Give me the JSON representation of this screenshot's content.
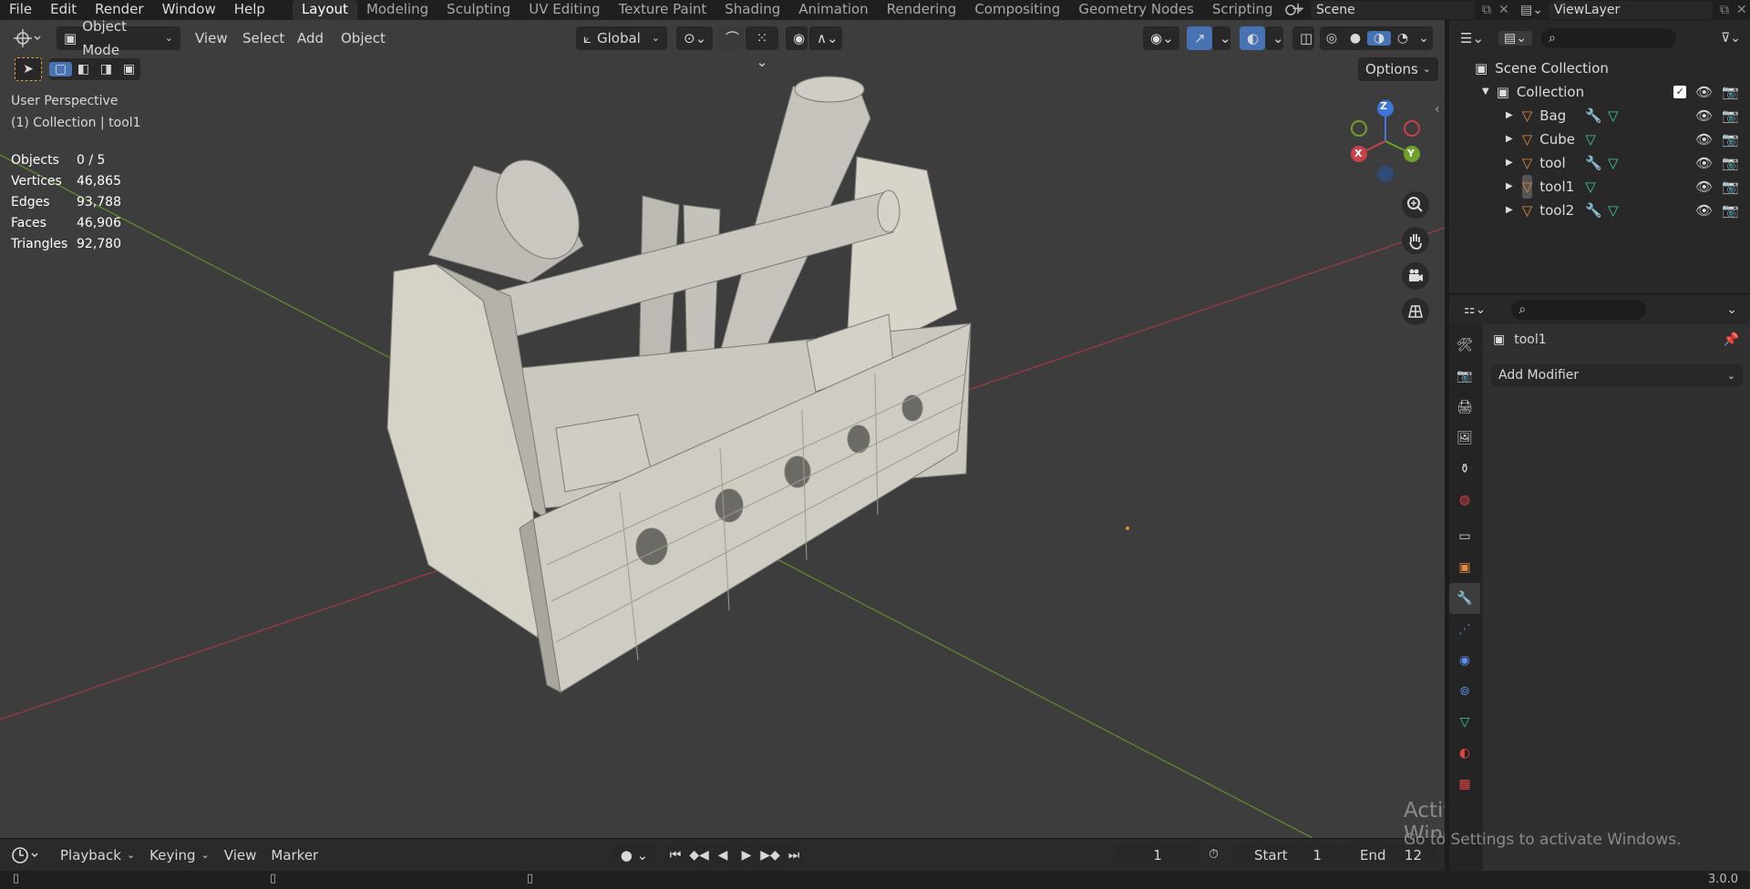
{
  "menus": [
    "File",
    "Edit",
    "Render",
    "Window",
    "Help"
  ],
  "workspaces": [
    "Layout",
    "Modeling",
    "Sculpting",
    "UV Editing",
    "Texture Paint",
    "Shading",
    "Animation",
    "Rendering",
    "Compositing",
    "Geometry Nodes",
    "Scripting"
  ],
  "active_workspace": "Layout",
  "scene_name": "Scene",
  "view_layer": "ViewLayer",
  "viewport": {
    "mode": "Object Mode",
    "menus": [
      "View",
      "Select",
      "Add",
      "Object"
    ],
    "transform_orientation": "Global",
    "options_label": "Options",
    "perspective": "User Perspective",
    "collection_info": "(1) Collection | tool1",
    "stats": [
      {
        "label": "Objects",
        "value": "0 / 5"
      },
      {
        "label": "Vertices",
        "value": "46,865"
      },
      {
        "label": "Edges",
        "value": "93,788"
      },
      {
        "label": "Faces",
        "value": "46,906"
      },
      {
        "label": "Triangles",
        "value": "92,780"
      }
    ],
    "gizmo": {
      "x": "X",
      "y": "Y",
      "z": "Z"
    }
  },
  "timeline": {
    "menus": [
      "Playback",
      "Keying",
      "View",
      "Marker"
    ],
    "current_frame": "1",
    "start_label": "Start",
    "start": "1",
    "end_label": "End",
    "end": "12"
  },
  "outliner": {
    "root": "Scene Collection",
    "collection": "Collection",
    "objects": [
      {
        "name": "Bag",
        "modifier": true
      },
      {
        "name": "Cube",
        "modifier": false
      },
      {
        "name": "tool",
        "modifier": true
      },
      {
        "name": "tool1",
        "modifier": false
      },
      {
        "name": "tool2",
        "modifier": true
      }
    ]
  },
  "properties": {
    "object_name": "tool1",
    "add_modifier": "Add Modifier"
  },
  "watermark": {
    "title": "Activate Windows",
    "subtitle": "Go to Settings to activate Windows."
  },
  "version": "3.0.0",
  "colors": {
    "accent_blue": "#4772b3",
    "x_axis": "#c9424a",
    "y_axis": "#6fa02a",
    "z_axis": "#3c76d8",
    "object_orange": "#e2893f",
    "mesh_green": "#3ec7a5"
  }
}
